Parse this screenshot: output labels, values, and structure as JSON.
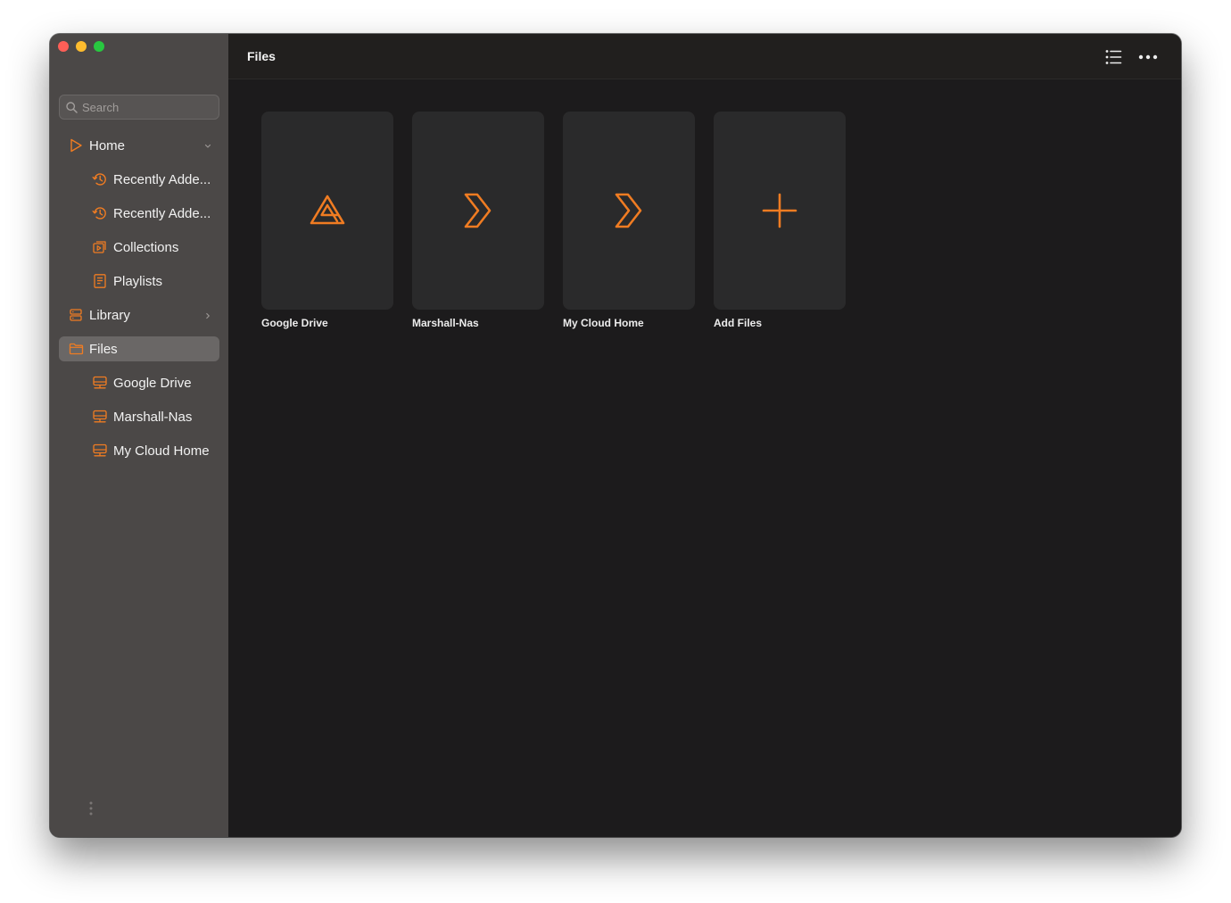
{
  "accent": "#f07c22",
  "window": {
    "traffic_lights": [
      "close",
      "minimize",
      "zoom"
    ]
  },
  "sidebar": {
    "search": {
      "placeholder": "Search",
      "value": ""
    },
    "items": [
      {
        "label": "Home",
        "icon": "play-triangle-icon",
        "level": 0,
        "chevron": "down"
      },
      {
        "label": "Recently Adde...",
        "icon": "history-icon",
        "level": 1
      },
      {
        "label": "Recently Adde...",
        "icon": "history-icon",
        "level": 1
      },
      {
        "label": "Collections",
        "icon": "collections-icon",
        "level": 1
      },
      {
        "label": "Playlists",
        "icon": "playlist-icon",
        "level": 1
      },
      {
        "label": "Library",
        "icon": "library-icon",
        "level": 0,
        "chevron": "right"
      },
      {
        "label": "Files",
        "icon": "folder-icon",
        "level": 0,
        "selected": true
      },
      {
        "label": "Google Drive",
        "icon": "network-drive-icon",
        "level": 1
      },
      {
        "label": "Marshall-Nas",
        "icon": "network-drive-icon",
        "level": 1
      },
      {
        "label": "My Cloud Home",
        "icon": "network-drive-icon",
        "level": 1
      }
    ]
  },
  "header": {
    "title": "Files",
    "buttons": [
      "list-view-icon",
      "more-options-icon"
    ]
  },
  "main": {
    "tiles": [
      {
        "label": "Google Drive",
        "icon": "google-drive-icon"
      },
      {
        "label": "Marshall-Nas",
        "icon": "chevron-server-icon"
      },
      {
        "label": "My Cloud Home",
        "icon": "chevron-server-icon"
      },
      {
        "label": "Add Files",
        "icon": "plus-icon"
      }
    ]
  }
}
